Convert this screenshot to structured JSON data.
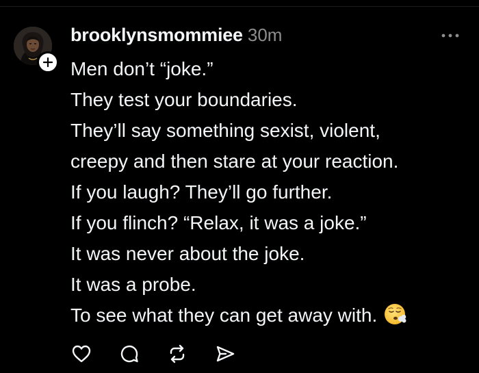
{
  "post": {
    "username": "brooklynsmommiee",
    "timestamp": "30m",
    "lines": [
      "Men don’t “joke.”",
      "They test your boundaries.",
      "They’ll say something sexist, violent,",
      "creepy and then stare at your reaction.",
      "If you laugh? They’ll go further.",
      "If you flinch? “Relax, it was a joke.”",
      "It was never about the joke.",
      "It was a probe.",
      "To see what they can get away with."
    ],
    "trailing_emoji": "face-exhaling-icon"
  },
  "icons": {
    "avatar": "profile-photo",
    "follow": "plus-icon",
    "more": "more-dots-icon",
    "like": "heart-icon",
    "reply": "comment-icon",
    "repost": "repost-icon",
    "share": "send-icon"
  },
  "colors": {
    "background": "#000000",
    "text": "#f3f5f7",
    "muted": "#8e8e8e"
  }
}
